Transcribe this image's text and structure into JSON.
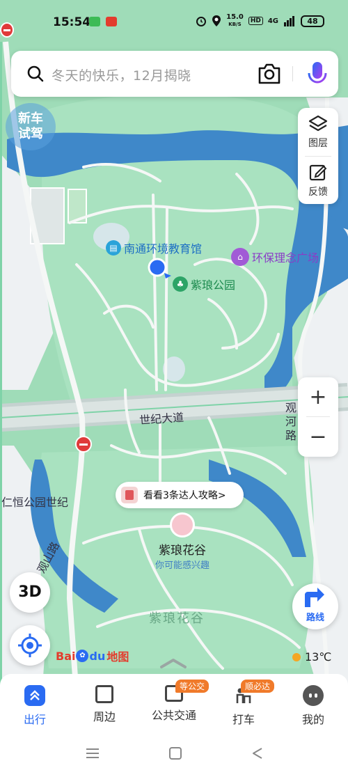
{
  "status_bar": {
    "time": "15:54",
    "speed_top": "15.0",
    "speed_unit": "KB/S",
    "hd": "HD",
    "network": "4G",
    "battery": "48"
  },
  "search": {
    "placeholder": "冬天的快乐，12月揭晓"
  },
  "map_tools": {
    "layers_label": "图层",
    "feedback_label": "反馈"
  },
  "zoom": {
    "in_label": "+",
    "out_label": "−"
  },
  "pois": {
    "museum": "南通环境教育馆",
    "square": "环保理念广场",
    "park": "紫琅公园",
    "valley": "紫琅花谷",
    "valley_sub": "你可能感兴趣",
    "valley_area": "紫琅花谷"
  },
  "roads": {
    "shiji": "世纪大道",
    "guanhe": "观河路",
    "guanshan": "观山路",
    "renheng": "仁恒公园世纪"
  },
  "guide_chip": "看看3条达人攻略>",
  "watermark": "新车试驾",
  "buttons": {
    "three_d": "3D",
    "route": "路线"
  },
  "logo": {
    "bai": "Bai",
    "du": "du",
    "map": "地图"
  },
  "weather": "13℃",
  "bottom_nav": [
    {
      "label": "出行",
      "active": true,
      "badge": ""
    },
    {
      "label": "周边",
      "active": false,
      "badge": ""
    },
    {
      "label": "公共交通",
      "active": false,
      "badge": "等公交"
    },
    {
      "label": "打车",
      "active": false,
      "badge": "顺必达"
    },
    {
      "label": "我的",
      "active": false,
      "badge": ""
    }
  ],
  "colors": {
    "map_green": "#9fdcb8",
    "water": "#3f88c9",
    "road": "#f5f7f6",
    "accent": "#2a6bf2",
    "badge": "#f07a2a"
  }
}
